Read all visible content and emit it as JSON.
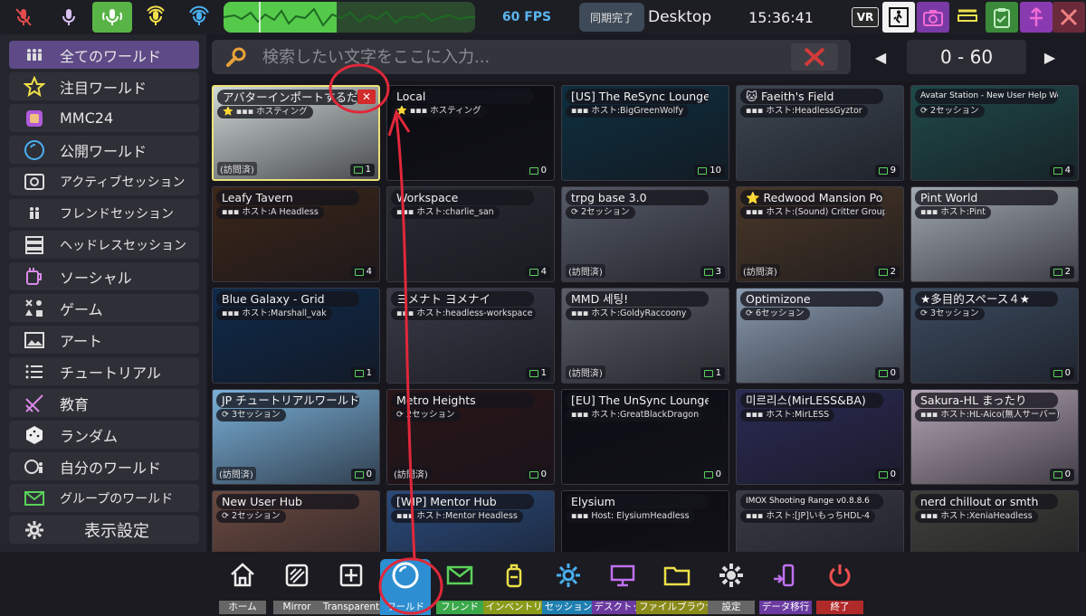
{
  "topbar": {
    "fps": "60 FPS",
    "sync_label": "同期完了",
    "desktop_label": "Desktop",
    "clock": "15:36:41",
    "vr_label": "VR",
    "colors": {
      "active": "#59b447",
      "voice": "#5ab6f0"
    },
    "icons": [
      "mic-muted-icon",
      "mic-whisper-icon",
      "mic-normal-icon",
      "mic-shout-icon",
      "mic-broadcast-icon",
      "vr-toggle-icon",
      "exit-person-icon",
      "camera-icon",
      "dash-icon",
      "clipboard-icon",
      "fork-icon",
      "close-icon"
    ]
  },
  "sidebar": {
    "items": [
      {
        "label": "全てのワールド",
        "icon": "all-worlds-icon"
      },
      {
        "label": "注目ワールド",
        "icon": "star-icon"
      },
      {
        "label": "MMC24",
        "icon": "mmc-icon"
      },
      {
        "label": "公開ワールド",
        "icon": "public-world-icon"
      },
      {
        "label": "アクティブセッション",
        "icon": "active-session-icon"
      },
      {
        "label": "フレンドセッション",
        "icon": "friend-session-icon"
      },
      {
        "label": "ヘッドレスセッション",
        "icon": "server-icon"
      },
      {
        "label": "ソーシャル",
        "icon": "social-mug-icon"
      },
      {
        "label": "ゲーム",
        "icon": "game-shapes-icon"
      },
      {
        "label": "アート",
        "icon": "picture-icon"
      },
      {
        "label": "チュートリアル",
        "icon": "tutorial-list-icon"
      },
      {
        "label": "教育",
        "icon": "education-icon"
      },
      {
        "label": "ランダム",
        "icon": "dice-icon"
      },
      {
        "label": "自分のワールド",
        "icon": "my-world-icon"
      },
      {
        "label": "グループのワールド",
        "icon": "mail-icon"
      },
      {
        "label": "表示設定",
        "icon": "gear-icon"
      }
    ]
  },
  "search": {
    "placeholder": "検索したい文字をここに入力..."
  },
  "pager": {
    "range": "0 - 60",
    "prev": "◀",
    "next": "▶"
  },
  "cards": [
    {
      "title": "アバターインポートするだけのワールド",
      "host": "⭐ ▪▪▪ ホスティング",
      "count": "1",
      "visited": "(訪問済)",
      "bg": "#cfd8d5"
    },
    {
      "title": "Local",
      "host": "⭐ ▪▪▪ ホスティング",
      "count": "0",
      "visited": "",
      "bg": "#0b0b12"
    },
    {
      "title": "[US] The ReSync Lounge",
      "host": "▪▪▪ ホスト:BigGreenWolfy",
      "count": "10",
      "visited": "",
      "bg": "#0e2f3f"
    },
    {
      "title": "🐱 Faeith's Field",
      "host": "▪▪▪ ホスト:HeadlessGyztor",
      "count": "9",
      "visited": "",
      "bg": "#3d4752"
    },
    {
      "title": "Avatar Station - New User Help World",
      "host": "⟳ 2セッション",
      "count": "4",
      "visited": "",
      "bg": "#1f4a4a"
    },
    {
      "title": "Leafy Tavern",
      "host": "▪▪▪ ホスト:A Headless",
      "count": "4",
      "visited": "",
      "bg": "#3b2619"
    },
    {
      "title": "Workspace",
      "host": "▪▪▪ ホスト:charlie_san",
      "count": "4",
      "visited": "",
      "bg": "#2a2a33"
    },
    {
      "title": "trpg base 3.0",
      "host": "⟳ 2セッション",
      "count": "3",
      "visited": "(訪問済)",
      "bg": "#555a66"
    },
    {
      "title": "⭐ Redwood Mansion Pool",
      "host": "▪▪▪ ホスト:(Sound) Critter Group Headless",
      "count": "2",
      "visited": "(訪問済)",
      "bg": "#4a3828"
    },
    {
      "title": "Pint World",
      "host": "▪▪▪ ホスト:Pint",
      "count": "2",
      "visited": "",
      "bg": "#a2a9b0"
    },
    {
      "title": "Blue Galaxy - Grid",
      "host": "▪▪▪ ホスト:Marshall_vak",
      "count": "1",
      "visited": "",
      "bg": "#0f2a4a"
    },
    {
      "title": "ヨメナト ヨメナイ",
      "host": "▪▪▪ ホスト:headless-workspace",
      "count": "1",
      "visited": "",
      "bg": "#3a3a48"
    },
    {
      "title": "MMD 세팅!",
      "host": "▪▪▪ ホスト:GoldyRaccoony",
      "count": "1",
      "visited": "(訪問済)",
      "bg": "#5a5e66"
    },
    {
      "title": "Optimizone",
      "host": "⟳ 6セッション",
      "count": "0",
      "visited": "",
      "bg": "#8a9bb0"
    },
    {
      "title": "★多目的スペース４★",
      "host": "⟳ 3セッション",
      "count": "0",
      "visited": "",
      "bg": "#3c4c60"
    },
    {
      "title": "JP チュートリアルワールド Resonite",
      "host": "⟳ 3セッション",
      "count": "0",
      "visited": "(訪問済)",
      "bg": "#7ab0d8"
    },
    {
      "title": "Metro Heights",
      "host": "⟳ 2セッション",
      "count": "0",
      "visited": "(訪問済)",
      "bg": "#2a1518"
    },
    {
      "title": "[EU] The UnSync Lounge",
      "host": "▪▪▪ ホスト:GreatBlackDragon",
      "count": "0",
      "visited": "",
      "bg": "#0c0c14"
    },
    {
      "title": "미르리스(MirLESS&BA)",
      "host": "▪▪▪ ホスト:MirLESS",
      "count": "0",
      "visited": "",
      "bg": "#2b2b55"
    },
    {
      "title": "Sakura-HL まったり",
      "host": "▪▪▪ ホスト:HL-Aico(無人サーバー)",
      "count": "0",
      "visited": "",
      "bg": "#b6a6b6"
    },
    {
      "title": "New User Hub",
      "host": "⟳ 2セッション",
      "count": "",
      "visited": "",
      "bg": "#6a4a40"
    },
    {
      "title": "[WIP] Mentor Hub",
      "host": "▪▪▪ ホスト:Mentor Headless",
      "count": "",
      "visited": "",
      "bg": "#2a4a7a"
    },
    {
      "title": "Elysium",
      "host": "▪▪▪ Host: ElysiumHeadless",
      "count": "",
      "visited": "",
      "bg": "#0c0c12"
    },
    {
      "title": "IMOX Shooting Range v0.8.8.6",
      "host": "▪▪▪ ホスト:[JP]いもっちHDL-4",
      "count": "",
      "visited": "",
      "bg": "#3a3a44"
    },
    {
      "title": "nerd chillout or smth",
      "host": "▪▪▪ ホスト:XeniaHeadless",
      "count": "",
      "visited": "",
      "bg": "#40403a"
    }
  ],
  "dock": [
    {
      "label": "ホーム",
      "icon": "home-icon",
      "bg": "#666666"
    },
    {
      "label": "Mirror",
      "icon": "mirror-icon",
      "bg": "#666666"
    },
    {
      "label": "Transparent",
      "icon": "transparent-icon",
      "bg": "#666666"
    },
    {
      "label": "ワールド",
      "icon": "world-icon",
      "bg": "#2d8fd1"
    },
    {
      "label": "フレンド",
      "icon": "friend-mail-icon",
      "bg": "#3aa84a"
    },
    {
      "label": "インベントリ",
      "icon": "inventory-icon",
      "bg": "#8a9a1a"
    },
    {
      "label": "セッション",
      "icon": "session-gear-icon",
      "bg": "#1f7fb0"
    },
    {
      "label": "デスクトップ",
      "icon": "desktop-monitor-icon",
      "bg": "#6a3aa0"
    },
    {
      "label": "ファイルブラウザ",
      "icon": "folder-icon",
      "bg": "#8a8a1a"
    },
    {
      "label": "設定",
      "icon": "settings-gear-icon",
      "bg": "#666666"
    },
    {
      "label": "データ移行",
      "icon": "data-migrate-icon",
      "bg": "#6a3aa0"
    },
    {
      "label": "終了",
      "icon": "power-icon",
      "bg": "#b02a2a"
    }
  ]
}
